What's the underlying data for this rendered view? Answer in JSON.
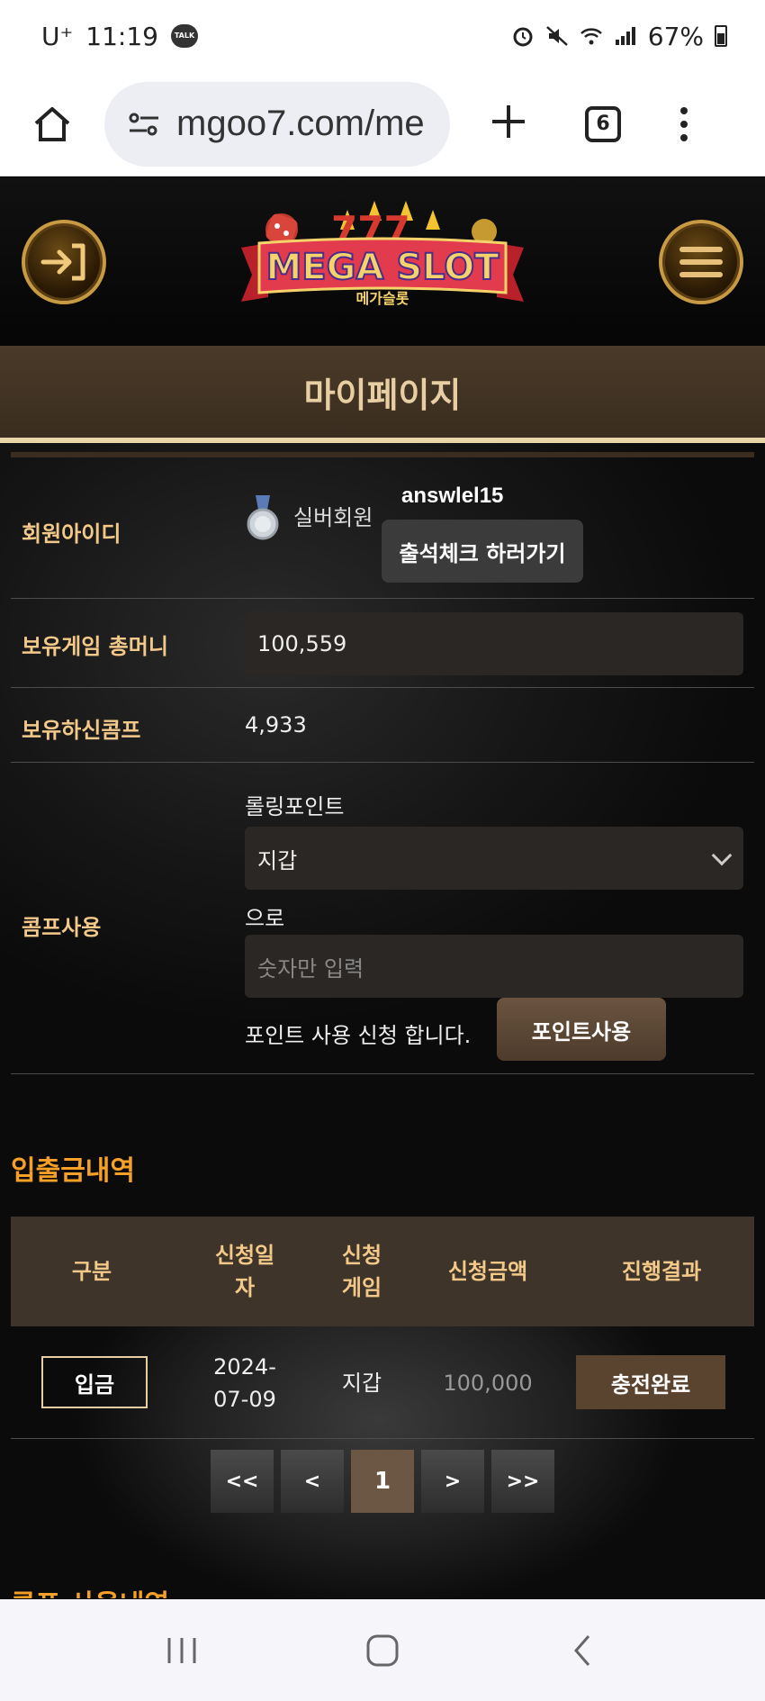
{
  "status_bar": {
    "carrier": "U⁺",
    "time": "11:19",
    "battery": "67%"
  },
  "browser": {
    "url": "mgoo7.com/me",
    "tab_count": "6"
  },
  "site": {
    "logo_main": "MEGA SLOT",
    "logo_sub": "메가슬롯",
    "page_title": "마이페이지"
  },
  "member": {
    "label": "회원아이디",
    "grade": "실버회원",
    "user_id": "answlel15",
    "attendance_button": "출석체크 하러가기"
  },
  "money": {
    "label": "보유게임 총머니",
    "value": "100,559"
  },
  "comp": {
    "label": "보유하신콤프",
    "value": "4,933"
  },
  "comp_use": {
    "label": "콤프사용",
    "rolling_label": "롤링포인트",
    "select_value": "지갑",
    "to_label": "으로",
    "amount_placeholder": "숫자만 입력",
    "apply_text": "포인트 사용 신청 합니다.",
    "apply_button": "포인트사용"
  },
  "history": {
    "title": "입출금내역",
    "columns": [
      "구분",
      "신청일\n자",
      "신청\n게임",
      "신청금액",
      "진행결과"
    ],
    "rows": [
      {
        "type": "입금",
        "date": "2024-\n07-09",
        "game": "지갑",
        "amount": "100,000",
        "result": "충전완료"
      }
    ]
  },
  "pagination": {
    "first": "<<",
    "prev": "<",
    "current": "1",
    "next": ">",
    "last": ">>"
  },
  "next_section_title": "콤프 사용내역"
}
